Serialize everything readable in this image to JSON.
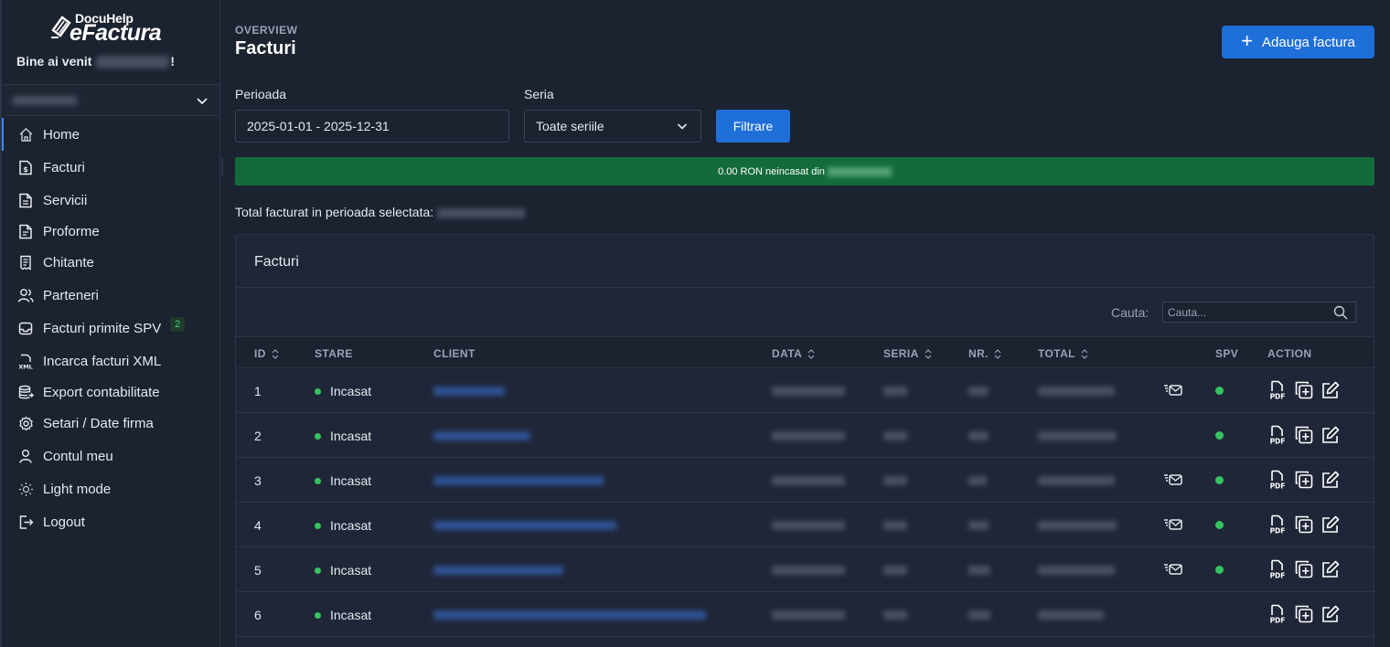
{
  "brand": {
    "top": "DocuHelp",
    "main": "eFactura"
  },
  "sidebar": {
    "welcome_prefix": "Bine ai venit ",
    "welcome_suffix": "!",
    "items": [
      {
        "label": "Home",
        "icon": "home-icon"
      },
      {
        "label": "Facturi",
        "icon": "invoice-dollar-icon"
      },
      {
        "label": "Servicii",
        "icon": "document-icon"
      },
      {
        "label": "Proforme",
        "icon": "document-lines-icon"
      },
      {
        "label": "Chitante",
        "icon": "receipt-icon"
      },
      {
        "label": "Parteneri",
        "icon": "users-icon"
      },
      {
        "label": "Facturi primite SPV",
        "icon": "inbox-icon",
        "badge": "2"
      },
      {
        "label": "Incarca facturi XML",
        "icon": "xml-file-icon"
      },
      {
        "label": "Export contabilitate",
        "icon": "database-export-icon"
      },
      {
        "label": "Setari / Date firma",
        "icon": "gear-icon"
      },
      {
        "label": "Contul meu",
        "icon": "user-icon"
      },
      {
        "label": "Light mode",
        "icon": "sun-icon"
      },
      {
        "label": "Logout",
        "icon": "logout-icon"
      }
    ]
  },
  "header": {
    "overview": "OVERVIEW",
    "title": "Facturi",
    "add_button": "Adauga factura"
  },
  "filters": {
    "period_label": "Perioada",
    "period_value": "2025-01-01 - 2025-12-31",
    "series_label": "Seria",
    "series_value": "Toate seriile",
    "filter_button": "Filtrare"
  },
  "progress": {
    "text": "0.00 RON neincasat din",
    "fraction": 1.0,
    "color": "#146b3a"
  },
  "total_label": "Total facturat in perioada selectata:",
  "table": {
    "title": "Facturi",
    "search_label": "Cauta:",
    "search_placeholder": "Cauta...",
    "columns": [
      "ID",
      "STARE",
      "CLIENT",
      "DATA",
      "SERIA",
      "NR.",
      "TOTAL",
      "SPV",
      "ACTION"
    ],
    "rows": [
      {
        "id": "1",
        "stare": "Incasat",
        "mail": true,
        "spv": true
      },
      {
        "id": "2",
        "stare": "Incasat",
        "mail": false,
        "spv": true
      },
      {
        "id": "3",
        "stare": "Incasat",
        "mail": true,
        "spv": true
      },
      {
        "id": "4",
        "stare": "Incasat",
        "mail": true,
        "spv": true
      },
      {
        "id": "5",
        "stare": "Incasat",
        "mail": true,
        "spv": true
      },
      {
        "id": "6",
        "stare": "Incasat",
        "mail": false,
        "spv": false
      }
    ]
  },
  "colors": {
    "accent": "#1f6fd8",
    "success": "#36c35f",
    "background": "#1b2230",
    "card": "#1f2637"
  }
}
